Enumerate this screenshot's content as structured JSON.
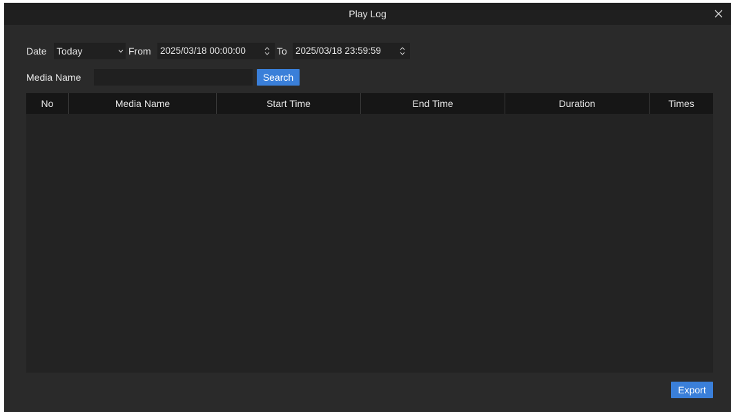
{
  "window": {
    "title": "Play Log"
  },
  "filters": {
    "date_label": "Date",
    "date_value": "Today",
    "from_label": "From",
    "from_value": "2025/03/18 00:00:00",
    "to_label": "To",
    "to_value": "2025/03/18 23:59:59",
    "media_name_label": "Media Name",
    "media_name_value": "",
    "media_name_placeholder": "",
    "search_label": "Search"
  },
  "table": {
    "columns": [
      "No",
      "Media Name",
      "Start Time",
      "End Time",
      "Duration",
      "Times"
    ],
    "rows": []
  },
  "footer": {
    "export_label": "Export"
  },
  "colors": {
    "background": "#2a2a2a",
    "titlebar": "#1f1f1f",
    "header": "#161616",
    "accent": "#3a7fd9"
  },
  "icons": {
    "close": "close-icon",
    "dropdown": "chevron-down-icon",
    "spinner": "spinner-updown-icon"
  }
}
